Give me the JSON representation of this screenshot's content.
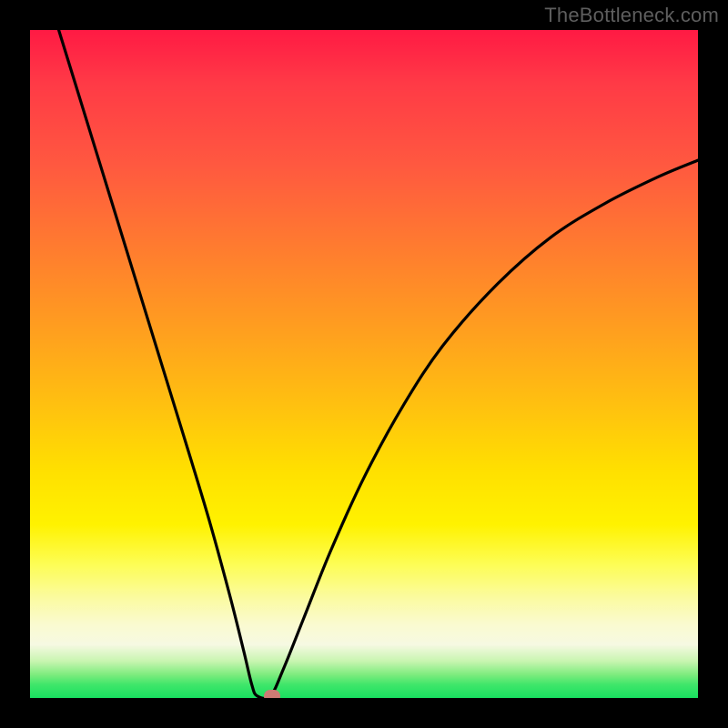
{
  "watermark": "TheBottleneck.com",
  "chart_data": {
    "type": "line",
    "title": "",
    "xlabel": "",
    "ylabel": "",
    "xlim": [
      0,
      100
    ],
    "ylim": [
      0,
      100
    ],
    "grid": false,
    "curve": {
      "min_x": 34,
      "points": [
        {
          "x": 4.3,
          "y": 100
        },
        {
          "x": 8,
          "y": 88
        },
        {
          "x": 12,
          "y": 75
        },
        {
          "x": 16,
          "y": 62
        },
        {
          "x": 20,
          "y": 49
        },
        {
          "x": 24,
          "y": 36
        },
        {
          "x": 27,
          "y": 26
        },
        {
          "x": 30,
          "y": 15
        },
        {
          "x": 32,
          "y": 7
        },
        {
          "x": 33.2,
          "y": 2
        },
        {
          "x": 34,
          "y": 0.3
        },
        {
          "x": 36,
          "y": 0.3
        },
        {
          "x": 38,
          "y": 4.5
        },
        {
          "x": 41,
          "y": 12
        },
        {
          "x": 45,
          "y": 22
        },
        {
          "x": 50,
          "y": 33
        },
        {
          "x": 56,
          "y": 44
        },
        {
          "x": 62,
          "y": 53
        },
        {
          "x": 70,
          "y": 62
        },
        {
          "x": 78,
          "y": 69
        },
        {
          "x": 86,
          "y": 74
        },
        {
          "x": 94,
          "y": 78
        },
        {
          "x": 100,
          "y": 80.5
        }
      ]
    },
    "marker": {
      "x": 36.3,
      "y": 0.3,
      "color": "#cd7b74"
    },
    "gradient_stops": [
      {
        "pct": 0,
        "color": "#ff1a44"
      },
      {
        "pct": 50,
        "color": "#ffc400"
      },
      {
        "pct": 80,
        "color": "#fdfd60"
      },
      {
        "pct": 100,
        "color": "#18e060"
      }
    ]
  }
}
